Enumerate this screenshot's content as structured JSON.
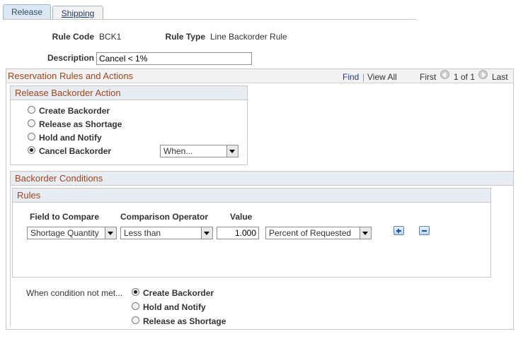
{
  "tabs": [
    {
      "label": "Release"
    },
    {
      "label": "Shipping"
    }
  ],
  "header": {
    "rule_code_label": "Rule Code",
    "rule_code_value": "BCK1",
    "rule_type_label": "Rule Type",
    "rule_type_value": "Line Backorder Rule",
    "description_label": "Description",
    "description_value": "Cancel < 1%"
  },
  "reservation": {
    "title": "Reservation Rules and Actions",
    "find": "Find",
    "sep": "|",
    "view_all": "View All",
    "first": "First",
    "counter": "1 of 1",
    "last": "Last"
  },
  "release_action": {
    "title": "Release Backorder Action",
    "options": [
      "Create Backorder",
      "Release as Shortage",
      "Hold and Notify",
      "Cancel Backorder"
    ],
    "selected": "Cancel Backorder",
    "when_select": "When..."
  },
  "conditions": {
    "title": "Backorder Conditions",
    "rules_title": "Rules",
    "columns": [
      "Field to Compare",
      "Comparison Operator",
      "Value"
    ],
    "row": {
      "field": "Shortage Quantity",
      "operator": "Less than",
      "value": "1.000",
      "unit": "Percent of Requested"
    },
    "icons": {
      "add": "plus-icon",
      "delete": "minus-icon"
    }
  },
  "not_met": {
    "label": "When condition not met...",
    "options": [
      "Create Backorder",
      "Hold and Notify",
      "Release as Shortage"
    ],
    "selected": "Create Backorder"
  }
}
